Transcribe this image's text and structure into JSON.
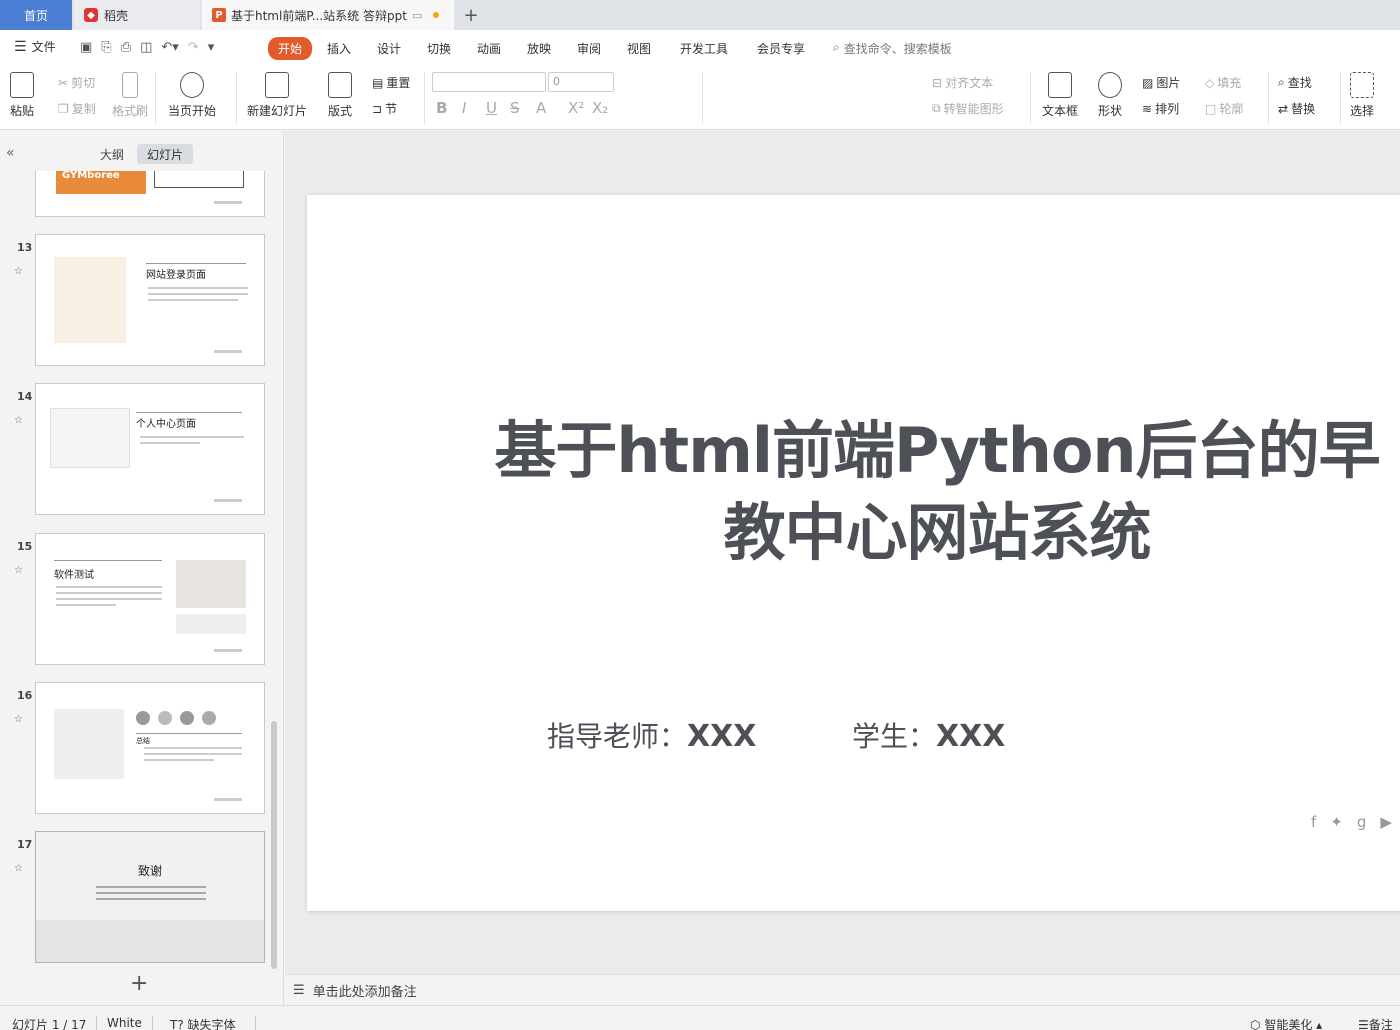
{
  "tabs": {
    "home": "首页",
    "daoke": "稻壳",
    "doc": "基于html前端P...站系统 答辩ppt",
    "add": "+"
  },
  "menu": {
    "file": "文件",
    "items": [
      "开始",
      "插入",
      "设计",
      "切换",
      "动画",
      "放映",
      "审阅",
      "视图",
      "开发工具",
      "会员专享"
    ],
    "search": "查找命令、搜索模板"
  },
  "ribbon": {
    "paste": "粘贴",
    "cut": "剪切",
    "copy": "复制",
    "format_painter": "格式刷",
    "start_current": "当页开始",
    "new_slide": "新建幻灯片",
    "layout": "版式",
    "reset": "重置",
    "section": "节",
    "font_size": "0",
    "align_text": "对齐文本",
    "smart_graphic": "转智能图形",
    "textbox": "文本框",
    "shape": "形状",
    "picture": "图片",
    "arrange": "排列",
    "fill": "填充",
    "outline": "轮廓",
    "find": "查找",
    "replace": "替换",
    "select": "选择"
  },
  "left_panel": {
    "outline_tab": "大纲",
    "slides_tab": "幻灯片",
    "thumbnails": [
      {
        "number": "13",
        "title": "网站登录页面"
      },
      {
        "number": "14",
        "title": "个人中心页面"
      },
      {
        "number": "15",
        "title": "软件测试"
      },
      {
        "number": "16",
        "title": "总结"
      },
      {
        "number": "17",
        "title": "致谢"
      }
    ],
    "partial_thumb_text": "GYMboree"
  },
  "slide": {
    "title_line1": "基于html前端Python后台的早",
    "title_line2": "教中心网站系统",
    "teacher_label": "指导老师：",
    "teacher_value": "XXX",
    "student_label": "学生：",
    "student_value": "XXX"
  },
  "notes": {
    "placeholder": "单击此处添加备注"
  },
  "status": {
    "slide_info": "幻灯片 1 / 17",
    "theme": "White",
    "missing_font": "缺失字体",
    "smart_beautify": "智能美化",
    "notes": "备注"
  },
  "colors": {
    "accent": "#e15b2d",
    "home_tab": "#4a7fd4",
    "title_text": "#4d5157"
  }
}
